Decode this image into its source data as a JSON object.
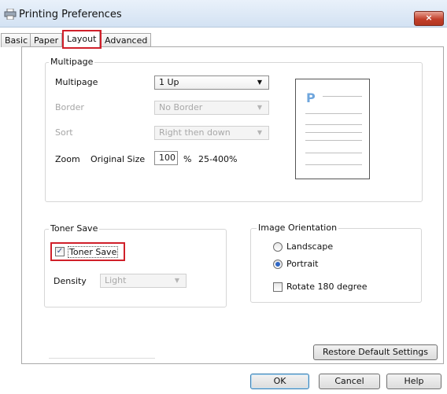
{
  "window": {
    "title": "Printing Preferences",
    "close_label": "×"
  },
  "tabs": [
    {
      "label": "Basic"
    },
    {
      "label": "Paper"
    },
    {
      "label": "Layout",
      "active": true
    },
    {
      "label": "Advanced"
    }
  ],
  "multipage": {
    "group_title": "Multipage",
    "multipage_label": "Multipage",
    "multipage_value": "1 Up",
    "border_label": "Border",
    "border_value": "No Border",
    "sort_label": "Sort",
    "sort_value": "Right then down",
    "zoom_label": "Zoom",
    "zoom_mode": "Original Size",
    "zoom_value": "100",
    "zoom_unit": "%",
    "zoom_range": "25-400%",
    "preview_letter": "P"
  },
  "toner_save": {
    "group_title": "Toner Save",
    "checkbox_label": "Toner Save",
    "checked": true,
    "density_label": "Density",
    "density_value": "Light"
  },
  "orientation": {
    "group_title": "Image Orientation",
    "landscape_label": "Landscape",
    "portrait_label": "Portrait",
    "selected": "Portrait",
    "rotate_label": "Rotate 180 degree",
    "rotate_checked": false
  },
  "buttons": {
    "restore": "Restore Default Settings",
    "ok": "OK",
    "cancel": "Cancel",
    "help": "Help"
  },
  "colors": {
    "highlight": "#d0202a",
    "accent": "#2f67c6"
  }
}
